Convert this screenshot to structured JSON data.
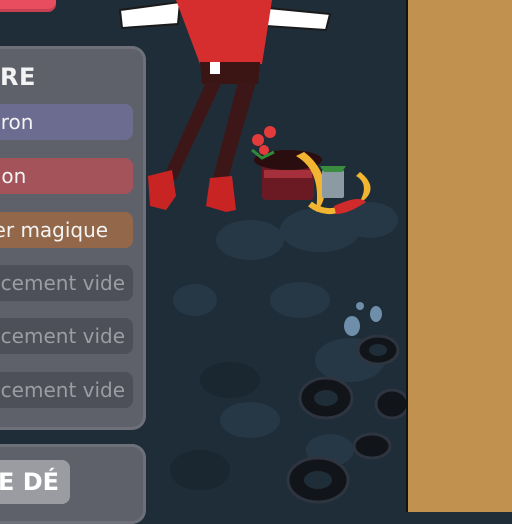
{
  "inventory": {
    "title": "RE",
    "slots": [
      {
        "label": "dron"
      },
      {
        "label": "tion"
      },
      {
        "label": "ier magique"
      },
      {
        "label": "ucement vide"
      },
      {
        "label": "ucement vide"
      },
      {
        "label": "ucement vide"
      }
    ]
  },
  "dice": {
    "button_label": "E DÉ"
  },
  "colors": {
    "background": "#1f2d38",
    "side_panel": "#c1914f",
    "panel": "#5e6169",
    "accent_red": "#e84c5f"
  }
}
